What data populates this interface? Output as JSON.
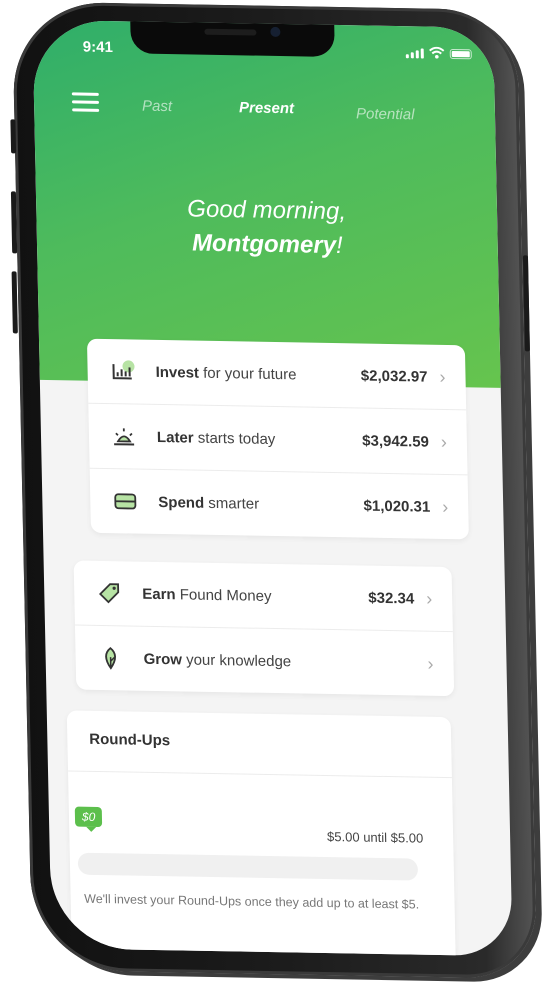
{
  "status_bar": {
    "time": "9:41"
  },
  "nav": {
    "tabs": [
      {
        "label": "Past",
        "active": false
      },
      {
        "label": "Present",
        "active": true
      },
      {
        "label": "Potential",
        "active": false
      }
    ]
  },
  "greeting": {
    "line1": "Good morning,",
    "name": "Montgomery",
    "suffix": "!"
  },
  "accounts": [
    {
      "bold": "Invest",
      "rest": " for your future",
      "amount": "$2,032.97",
      "icon": "chart-icon"
    },
    {
      "bold": "Later",
      "rest": " starts today",
      "amount": "$3,942.59",
      "icon": "sunrise-icon"
    },
    {
      "bold": "Spend",
      "rest": " smarter",
      "amount": "$1,020.31",
      "icon": "card-icon"
    }
  ],
  "extras": [
    {
      "bold": "Earn",
      "rest": " Found Money",
      "amount": "$32.34",
      "icon": "tag-icon"
    },
    {
      "bold": "Grow",
      "rest": " your knowledge",
      "amount": "",
      "icon": "leaf-icon"
    }
  ],
  "roundups": {
    "title": "Round-Ups",
    "current": "$0",
    "until": "$5.00 until $5.00",
    "progress_fraction": 0,
    "note": "We'll invest your Round-Ups once they add up to at least $5."
  },
  "colors": {
    "brand_green": "#5cbf4c",
    "hero_start": "#2fae6a",
    "hero_end": "#66c44e"
  }
}
